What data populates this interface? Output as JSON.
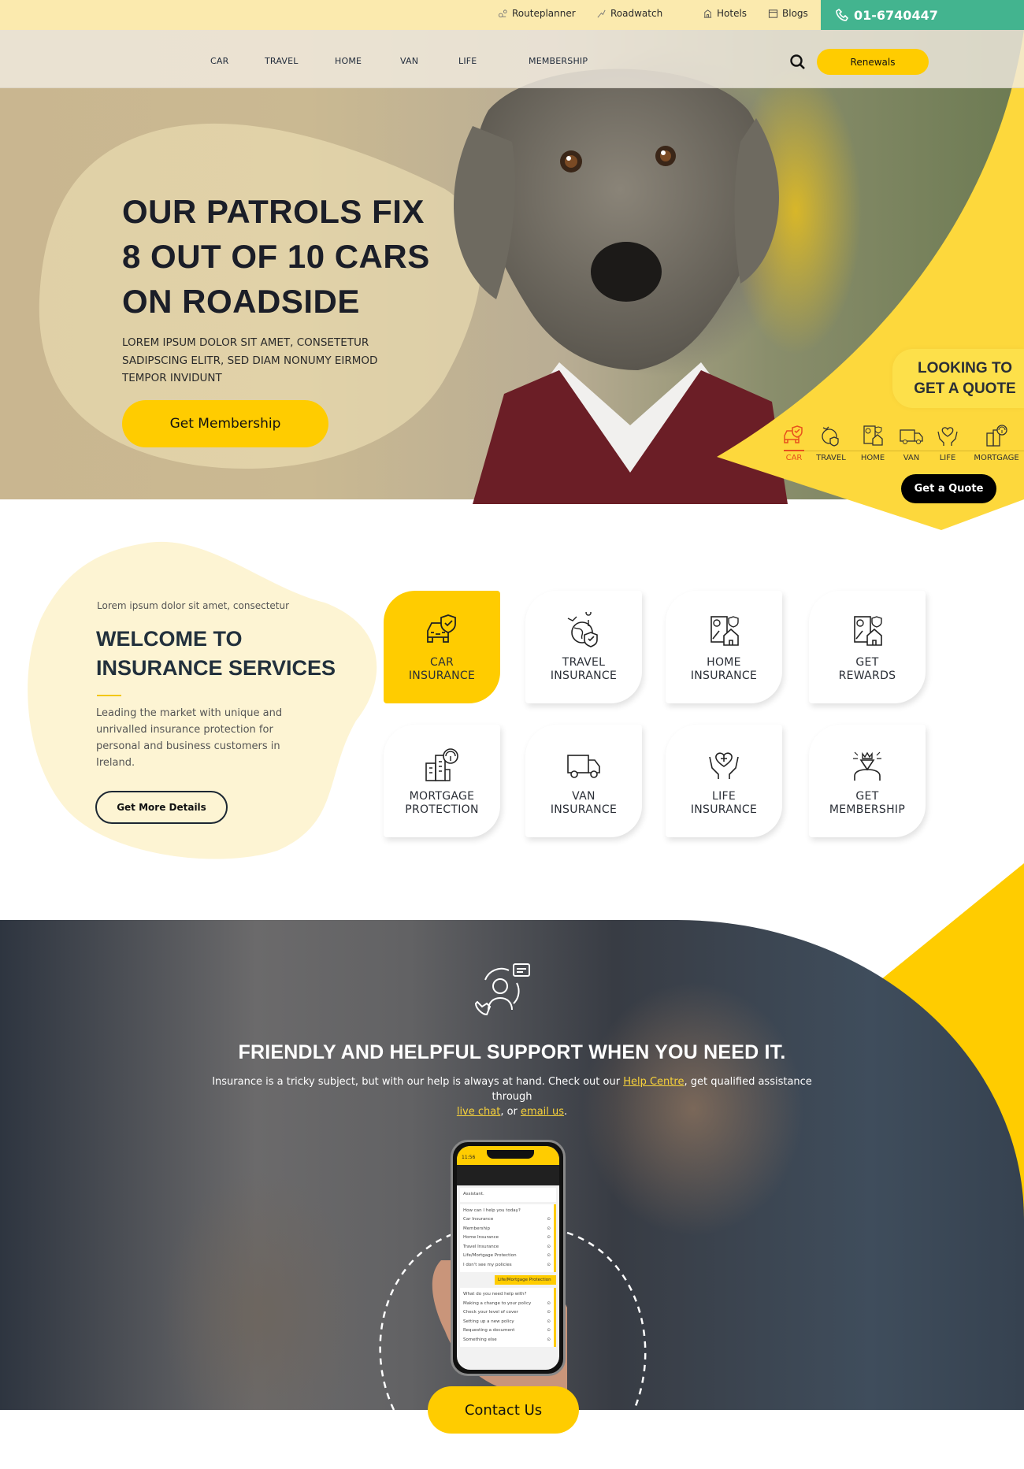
{
  "topbar": {
    "links": [
      {
        "label": "Routeplanner",
        "icon": "route-icon"
      },
      {
        "label": "Roadwatch",
        "icon": "roadwatch-icon"
      },
      {
        "label": "Hotels",
        "icon": "hotel-icon"
      },
      {
        "label": "Blogs",
        "icon": "blog-icon"
      }
    ],
    "phone": "01-6740447"
  },
  "nav": {
    "items": [
      "CAR",
      "TRAVEL",
      "HOME",
      "VAN",
      "LIFE",
      "MEMBERSHIP"
    ],
    "renewals_label": "Renewals"
  },
  "hero": {
    "title_lines": [
      "OUR PATROLS FIX",
      "8 OUT OF 10 CARS",
      "ON ROADSIDE"
    ],
    "subtitle": "LOREM IPSUM DOLOR SIT AMET, CONSETETUR SADIPSCING ELITR, SED DIAM NONUMY EIRMOD TEMPOR INVIDUNT",
    "cta_label": "Get Membership"
  },
  "quote": {
    "title_lines": [
      "LOOKING TO",
      "GET A QUOTE"
    ],
    "items": [
      {
        "label": "CAR",
        "icon": "car-shield-icon",
        "active": true
      },
      {
        "label": "TRAVEL",
        "icon": "travel-globe-icon",
        "active": false
      },
      {
        "label": "HOME",
        "icon": "home-document-icon",
        "active": false
      },
      {
        "label": "VAN",
        "icon": "van-icon",
        "active": false
      },
      {
        "label": "LIFE",
        "icon": "heart-hands-icon",
        "active": false
      },
      {
        "label": "MORTGAGE",
        "icon": "building-umbrella-icon",
        "active": false
      }
    ],
    "button_label": "Get a Quote",
    "active_color": "#e8501c"
  },
  "welcome": {
    "kicker": "Lorem ipsum dolor sit amet, consectetur",
    "title_lines": [
      "WELCOME TO",
      "INSURANCE SERVICES"
    ],
    "body": "Leading the market with unique and unrivalled insurance protection for personal and business customers in Ireland.",
    "button_label": "Get More Details"
  },
  "services": [
    {
      "lines": [
        "CAR",
        "INSURANCE"
      ],
      "icon": "car-shield-icon",
      "active": true
    },
    {
      "lines": [
        "TRAVEL",
        "INSURANCE"
      ],
      "icon": "travel-globe-icon",
      "active": false
    },
    {
      "lines": [
        "HOME",
        "INSURANCE"
      ],
      "icon": "home-document-icon",
      "active": false
    },
    {
      "lines": [
        "GET",
        "REWARDS"
      ],
      "icon": "rewards-document-icon",
      "active": false
    },
    {
      "lines": [
        "MORTGAGE",
        "PROTECTION"
      ],
      "icon": "building-umbrella-icon",
      "active": false
    },
    {
      "lines": [
        "VAN",
        "INSURANCE"
      ],
      "icon": "van-icon",
      "active": false
    },
    {
      "lines": [
        "LIFE",
        "INSURANCE"
      ],
      "icon": "heart-hands-icon",
      "active": false
    },
    {
      "lines": [
        "GET",
        "MEMBERSHIP"
      ],
      "icon": "diamond-person-icon",
      "active": false
    }
  ],
  "support": {
    "title": "FRIENDLY AND HELPFUL SUPPORT WHEN YOU NEED IT.",
    "text_before": "Insurance is a tricky subject, but with our help is always at hand. Check out our ",
    "link_help": "Help Centre",
    "text_mid": ", get qualified assistance through ",
    "link_chat": "live chat",
    "text_or": ", or ",
    "link_email": "email us",
    "text_end": ".",
    "contact_label": "Contact Us"
  },
  "phone_screen": {
    "status_time": "11:56",
    "assistant_label": "Assistant.",
    "question1": "How can I help you today?",
    "options1": [
      "Car Insurance",
      "Membership",
      "Home Insurance",
      "Travel Insurance",
      "Life/Mortgage Protection",
      "I don't see my policies"
    ],
    "reply": "Life/Mortgage Protection",
    "question2": "What do you need help with?",
    "options2": [
      "Making a change to your policy",
      "Check your level of cover",
      "Setting up a new policy",
      "Requesting a document",
      "Something else"
    ]
  },
  "colors": {
    "brand_yellow": "#ffcc00",
    "topbar_bg": "#fbeaae",
    "phone_bg": "#43b48f",
    "dark": "#1b1e28"
  }
}
